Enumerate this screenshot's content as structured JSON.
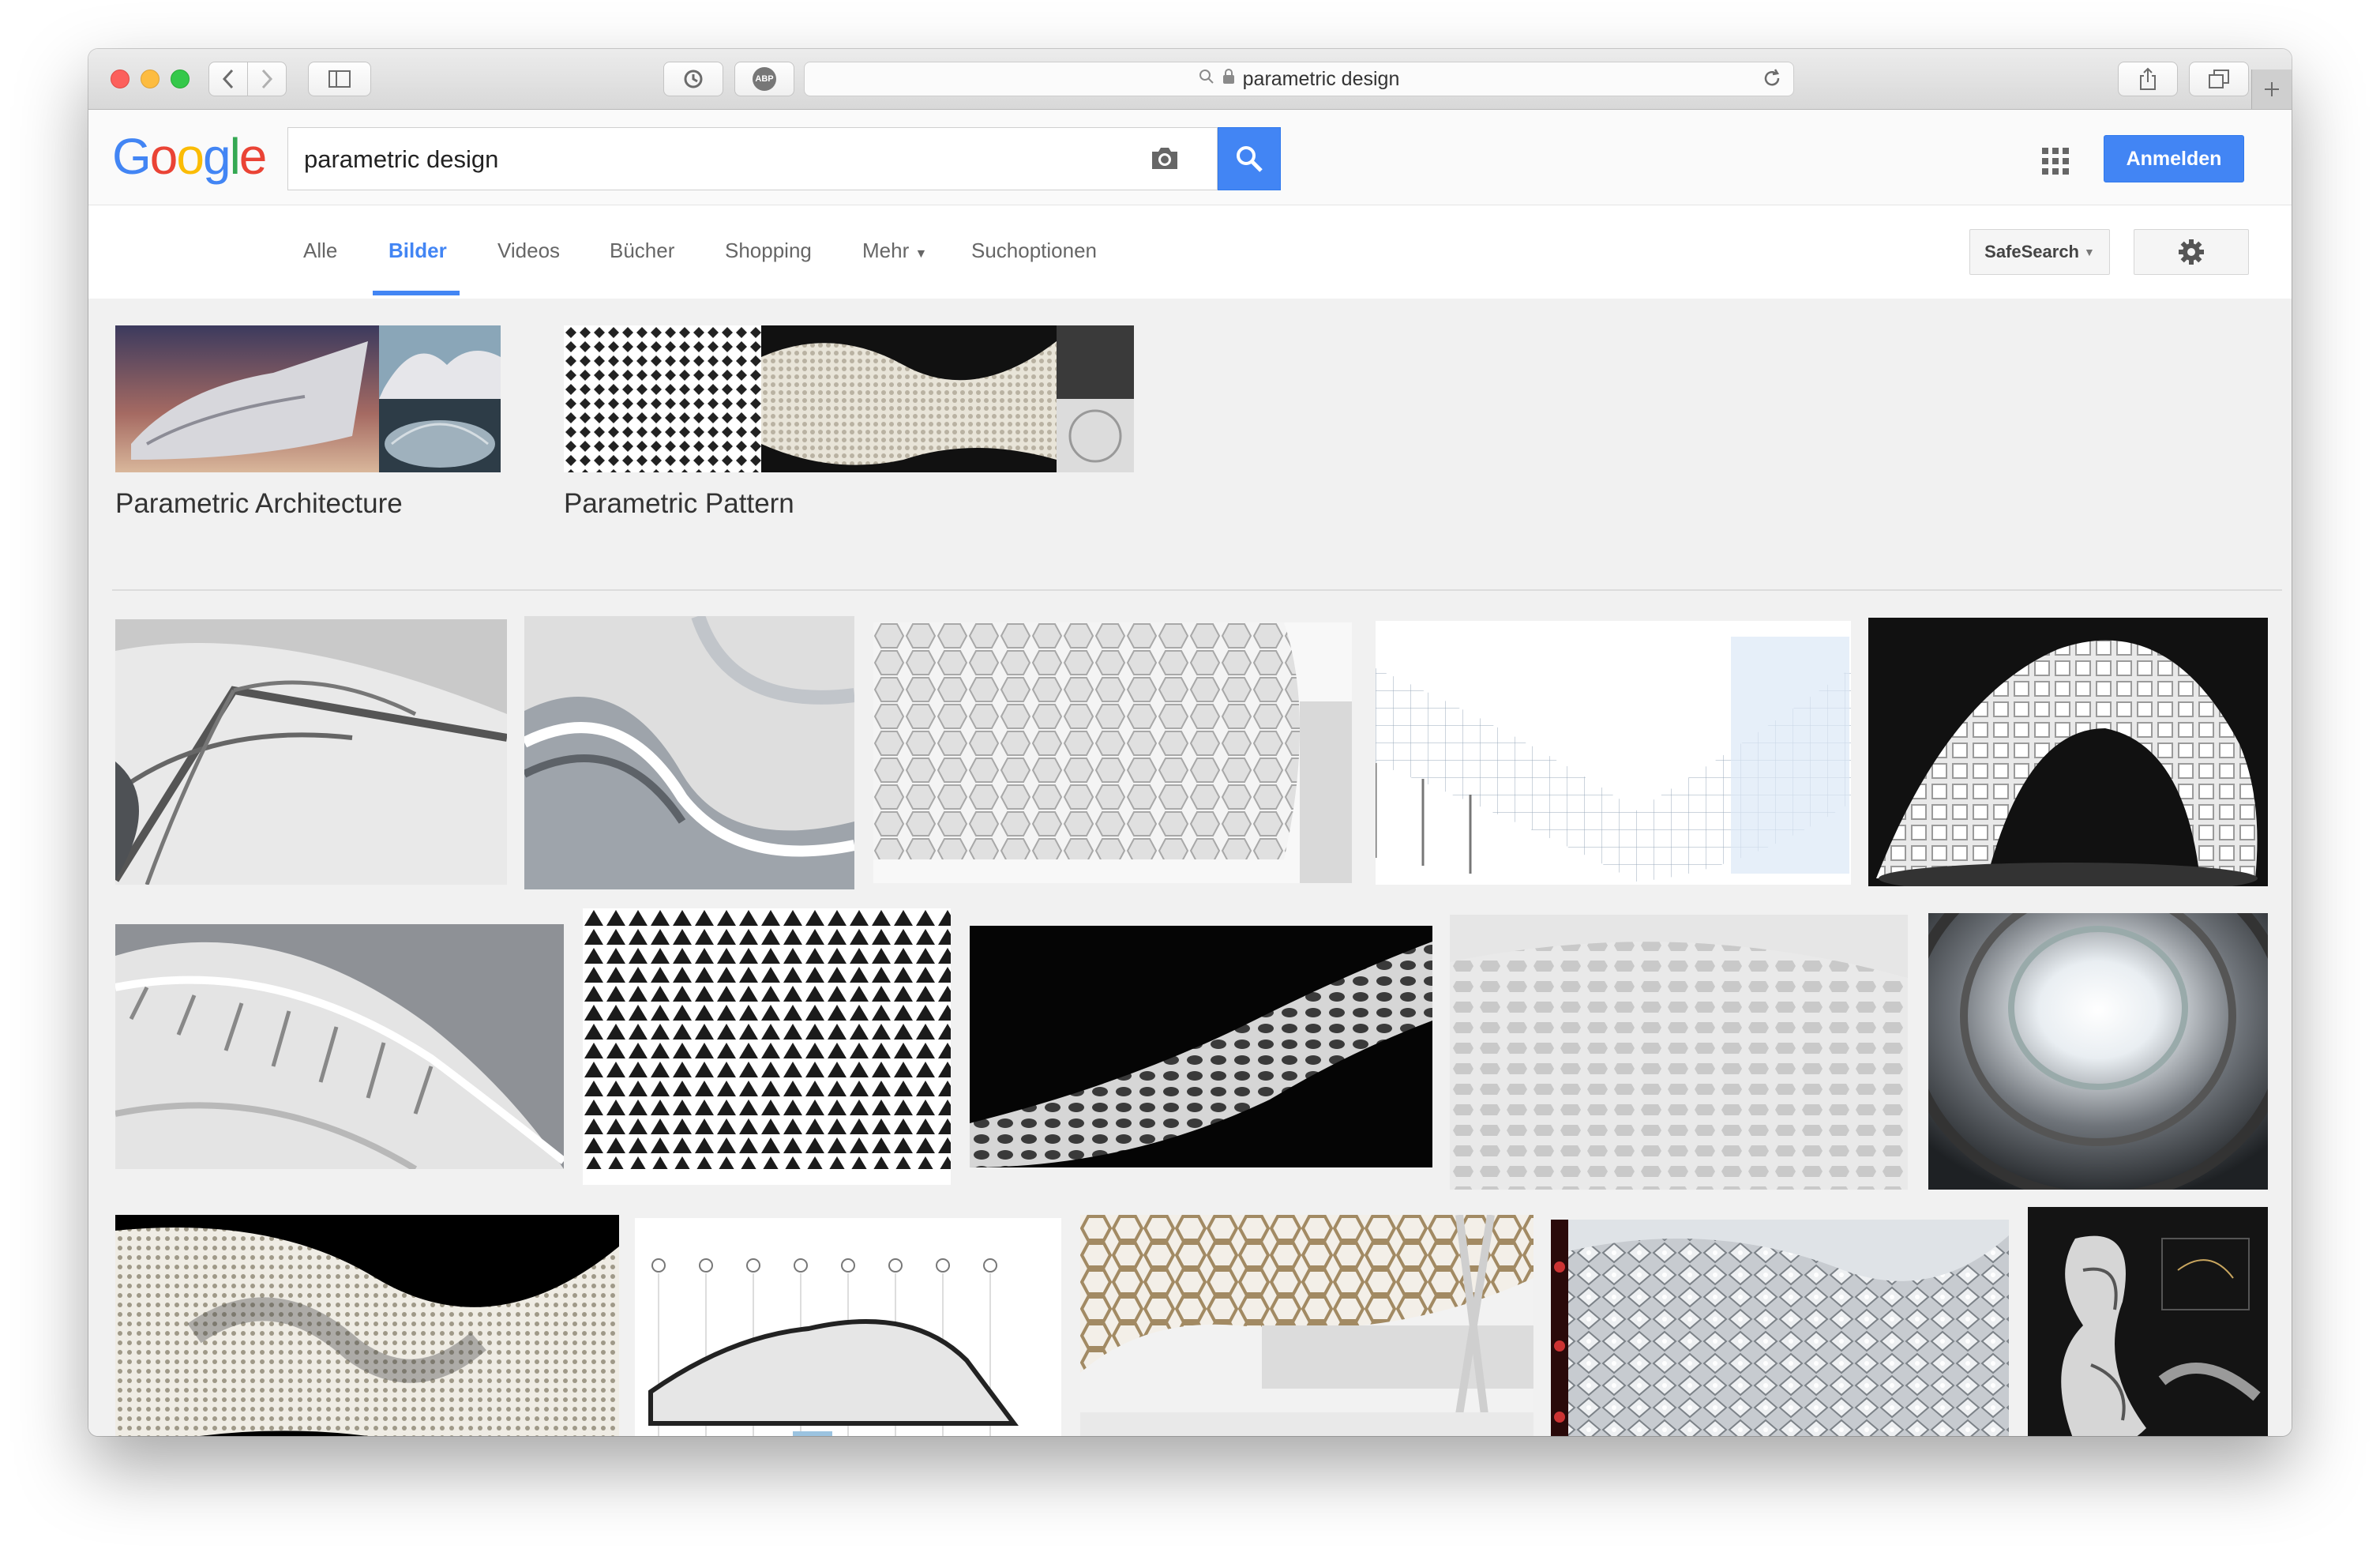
{
  "browser": {
    "url_text": "parametric design",
    "adblock_label": "ABP"
  },
  "google": {
    "logo_letters": [
      {
        "ch": "G",
        "color": "#4285f4"
      },
      {
        "ch": "o",
        "color": "#ea4335"
      },
      {
        "ch": "o",
        "color": "#fbbc05"
      },
      {
        "ch": "g",
        "color": "#4285f4"
      },
      {
        "ch": "l",
        "color": "#34a853"
      },
      {
        "ch": "e",
        "color": "#ea4335"
      }
    ],
    "query": "parametric design",
    "signin_label": "Anmelden"
  },
  "tabs": [
    {
      "label": "Alle",
      "active": false
    },
    {
      "label": "Bilder",
      "active": true
    },
    {
      "label": "Videos",
      "active": false
    },
    {
      "label": "Bücher",
      "active": false
    },
    {
      "label": "Shopping",
      "active": false
    },
    {
      "label": "Mehr",
      "active": false
    },
    {
      "label": "Suchoptionen",
      "active": false
    }
  ],
  "tools": {
    "safesearch_label": "SafeSearch"
  },
  "related": [
    {
      "label": "Parametric Architecture"
    },
    {
      "label": "Parametric Pattern"
    }
  ],
  "colors": {
    "accent_blue": "#4285f4"
  }
}
